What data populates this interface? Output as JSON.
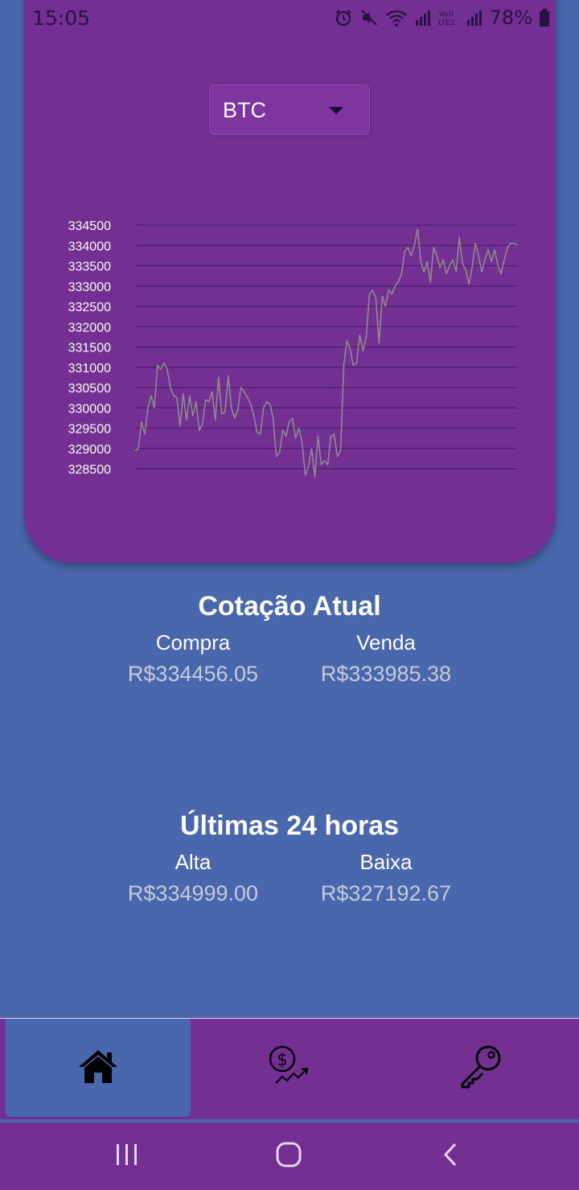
{
  "status_bar": {
    "time": "15:05",
    "battery": "78%",
    "icons": [
      "alarm-icon",
      "mute-icon",
      "wifi-icon",
      "signal-icon",
      "volte-icon",
      "signal-icon",
      "battery-icon"
    ]
  },
  "selector": {
    "value": "BTC"
  },
  "chart_data": {
    "type": "line",
    "series": [
      {
        "values": [
          328950,
          329000,
          329650,
          329350,
          330000,
          330300,
          330000,
          331050,
          330950,
          331100,
          330950,
          330500,
          330300,
          330250,
          329550,
          330350,
          329700,
          330300,
          329800,
          330150,
          329450,
          329600,
          330200,
          330150,
          330400,
          329700,
          330750,
          329850,
          329900,
          330800,
          330000,
          329750,
          329950,
          330500,
          330400,
          330250,
          330100,
          329800,
          329400,
          329350,
          330000,
          330150,
          330100,
          329750,
          328800,
          328900,
          329450,
          329300,
          329650,
          329750,
          329250,
          329500,
          329150,
          328350,
          328550,
          329000,
          328300,
          329300,
          328600,
          328700,
          328600,
          329300,
          329350,
          328800,
          328950,
          331050,
          331650,
          331450,
          331050,
          331100,
          331800,
          331400,
          331750,
          332800,
          332900,
          332700,
          331600,
          332750,
          332500,
          332900,
          332800,
          333000,
          333100,
          333300,
          333850,
          333950,
          333750,
          334000,
          334400,
          333600,
          333350,
          333600,
          333100,
          333950,
          333750,
          333450,
          333650,
          333300,
          333500,
          333650,
          333350,
          334200,
          333550,
          333400,
          333050,
          333450,
          334050,
          333750,
          333350,
          333650,
          333900,
          333600,
          333900,
          333500,
          333300,
          333650,
          333950,
          334050,
          334050,
          334000
        ],
        "color": "#8c8c8c"
      }
    ],
    "yticks": [
      "334500",
      "334000",
      "333500",
      "333000",
      "332500",
      "332000",
      "331500",
      "331000",
      "330500",
      "330000",
      "329500",
      "329000",
      "328500"
    ],
    "ylim": [
      328500,
      334500
    ],
    "grid": true,
    "grid_color": "#4e2070",
    "tick_color": "#ffffff"
  },
  "current": {
    "title": "Cotação Atual",
    "buy_label": "Compra",
    "buy_value": "R$334456.05",
    "sell_label": "Venda",
    "sell_value": "R$333985.38"
  },
  "last24": {
    "title": "Últimas 24 horas",
    "high_label": "Alta",
    "high_value": "R$334999.00",
    "low_label": "Baixa",
    "low_value": "R$327192.67"
  },
  "bottom_nav": {
    "items": [
      {
        "icon": "home-icon",
        "active": true
      },
      {
        "icon": "money-growth-icon",
        "active": false
      },
      {
        "icon": "key-icon",
        "active": false
      }
    ]
  },
  "system_nav": {
    "icons": [
      "recent-apps-icon",
      "home-circle-icon",
      "back-icon"
    ]
  },
  "colors": {
    "background": "#4967ac",
    "card": "#742f93",
    "text": "#ffffff",
    "value_text": "#c8cad6"
  }
}
